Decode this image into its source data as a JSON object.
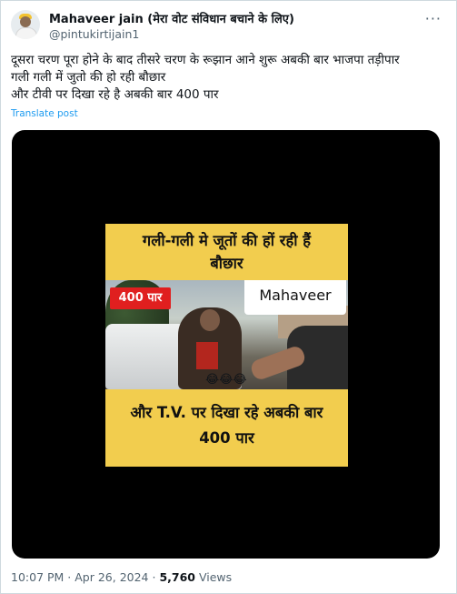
{
  "author": {
    "name": "Mahaveer jain (मेरा वोट संविधान बचाने के लिए)",
    "handle": "@pintukirtijain1",
    "more_icon": "more-horizontal-icon"
  },
  "tweet": {
    "lines": [
      "दूसरा चरण पूरा होने के बाद तीसरे चरण के रूझान आने शुरू अबकी बार भाजपा तड़ीपार",
      "गली गली में जुतो की हो रही बौछार",
      "और टीवी पर दिखा रहे है अबकी बार 400 पार"
    ],
    "translate_label": "Translate post"
  },
  "video": {
    "top_caption_line1": "गली-गली मे जूतों की हों रही हैं",
    "top_caption_line2": "बौछार",
    "badge": "400 पार",
    "name_tag": "Mahaveer",
    "emoji": "😂😂😂",
    "bottom_caption_line1": "और T.V. पर दिखा रहे अबकी बार",
    "bottom_caption_line2": "400 पार"
  },
  "meta": {
    "time": "10:07 PM",
    "separator": " · ",
    "date": "Apr 26, 2024",
    "views_count": "5,760",
    "views_label": " Views"
  }
}
